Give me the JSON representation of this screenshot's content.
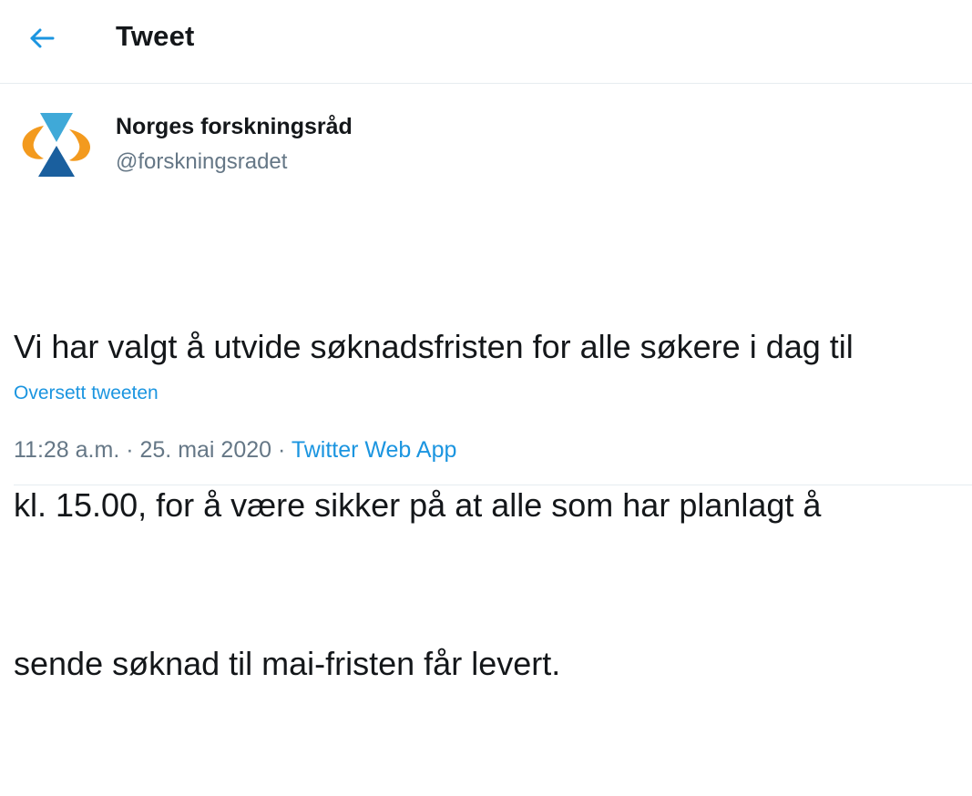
{
  "header": {
    "title": "Tweet",
    "back_icon": "arrow-left-icon"
  },
  "tweet": {
    "author": {
      "display_name": "Norges forskningsråd",
      "handle": "@forskningsradet",
      "avatar_icon": "forskningsradet-logo"
    },
    "text_lines": [
      "Vi har valgt å utvide søknadsfristen for alle søkere i dag til",
      "kl. 15.00, for å være sikker på at alle som har planlagt å",
      "sende søknad til mai-fristen får levert."
    ],
    "translate_label": "Oversett tweeten",
    "time": "11:28 a.m.",
    "separator": " · ",
    "date": "25. mai 2020",
    "source": "Twitter Web App"
  },
  "colors": {
    "accent": "#1b95e0",
    "text": "#14171a",
    "secondary": "#657786",
    "divider": "#e6ecf0",
    "logo_blue": "#1a5f9e",
    "logo_cyan": "#3fa9d8",
    "logo_orange": "#f39a1e"
  }
}
